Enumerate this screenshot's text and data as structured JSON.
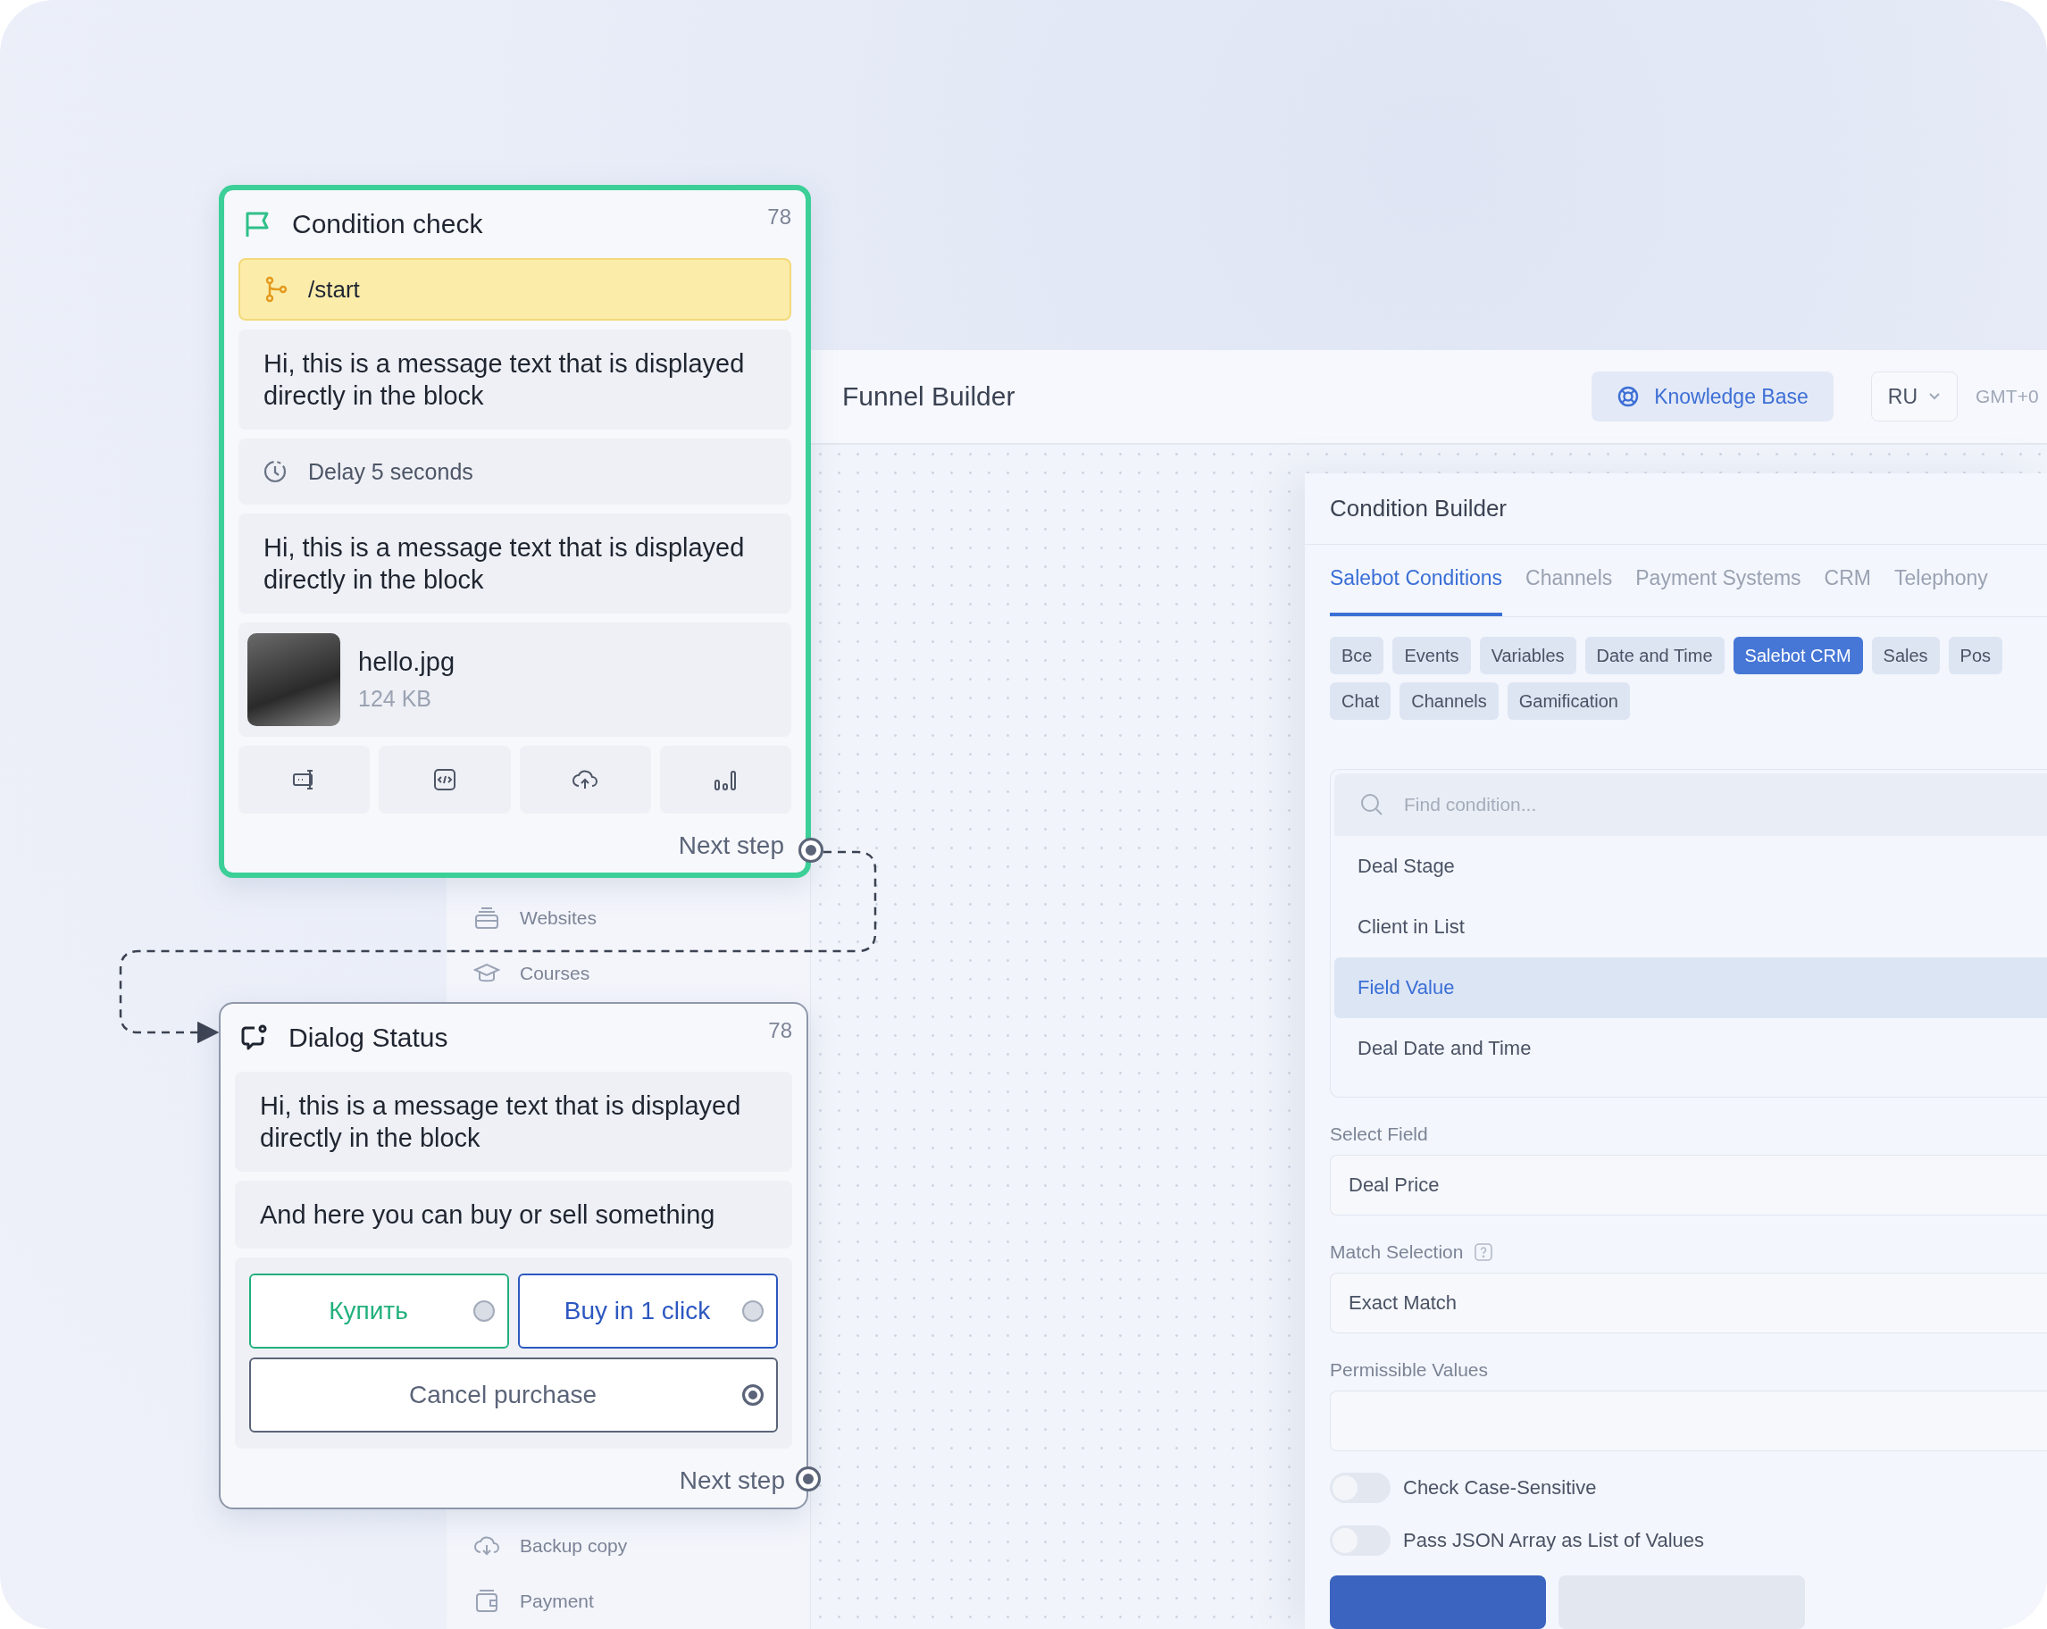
{
  "app": {
    "title": "Funnel Builder",
    "knowledge_base": "Knowledge Base",
    "language": "RU",
    "timezone": "GMT+0"
  },
  "sidebar": {
    "upper_items": [
      {
        "label": "Websites"
      },
      {
        "label": "Courses"
      }
    ],
    "lower_items": [
      {
        "label": "Backup copy"
      },
      {
        "label": "Payment"
      }
    ]
  },
  "condition_builder": {
    "title": "Condition Builder",
    "tabs": [
      {
        "label": "Salebot Conditions",
        "selected": true
      },
      {
        "label": "Channels",
        "selected": false
      },
      {
        "label": "Payment Systems",
        "selected": false
      },
      {
        "label": "CRM",
        "selected": false
      },
      {
        "label": "Telephony",
        "selected": false
      }
    ],
    "chip_rows": [
      [
        {
          "label": "Все",
          "selected": false
        },
        {
          "label": "Events",
          "selected": false
        },
        {
          "label": "Variables",
          "selected": false
        },
        {
          "label": "Date and Time",
          "selected": false
        },
        {
          "label": "Salebot CRM",
          "selected": true
        },
        {
          "label": "Sales",
          "selected": false
        },
        {
          "label": "Pos",
          "selected": false
        }
      ],
      [
        {
          "label": "Chat",
          "selected": false
        },
        {
          "label": "Channels",
          "selected": false
        },
        {
          "label": "Gamification",
          "selected": false
        }
      ]
    ],
    "search": {
      "placeholder": "Find condition..."
    },
    "conditions": [
      {
        "label": "Deal Stage",
        "selected": false
      },
      {
        "label": "Client in List",
        "selected": false
      },
      {
        "label": "Field Value",
        "selected": true
      },
      {
        "label": "Deal Date and Time",
        "selected": false
      }
    ],
    "fields": [
      {
        "label": "Select Field",
        "value": "Deal Price"
      },
      {
        "label": "Match Selection",
        "value": "Exact Match",
        "help": true
      },
      {
        "label": "Permissible Values"
      }
    ],
    "toggles": [
      {
        "label": "Check Case-Sensitive",
        "on": false
      },
      {
        "label": "Pass JSON Array as List of Values",
        "on": false
      }
    ]
  },
  "nodes": [
    {
      "kind": "condition",
      "title": "Condition check",
      "count": "78",
      "selected": true,
      "next": "Next step",
      "blocks": [
        {
          "kind": "trigger",
          "text": "/start"
        },
        {
          "kind": "message",
          "text": "Hi, this is a message text that is displayed directly in the block"
        },
        {
          "kind": "delay",
          "text": "Delay 5 seconds"
        },
        {
          "kind": "message",
          "text": "Hi, this is a message text that is displayed directly in the block"
        },
        {
          "kind": "file",
          "name": "hello.jpg",
          "size": "124 KB"
        },
        {
          "kind": "toolbar"
        }
      ]
    },
    {
      "kind": "dialog",
      "title": "Dialog Status",
      "count": "78",
      "selected": false,
      "next": "Next step",
      "blocks": [
        {
          "kind": "message",
          "text": "Hi, this is a message text that is displayed directly in the block"
        },
        {
          "kind": "message",
          "text": "And here you can buy or sell something"
        },
        {
          "kind": "buttons",
          "buttons": [
            {
              "label": "Купить",
              "color": "#22b07d",
              "connected": false
            },
            {
              "label": "Buy in 1 click",
              "color": "#2c57c0",
              "connected": false
            },
            {
              "label": "Cancel purchase",
              "color": "#5b6478",
              "connected": true
            }
          ]
        }
      ]
    }
  ]
}
